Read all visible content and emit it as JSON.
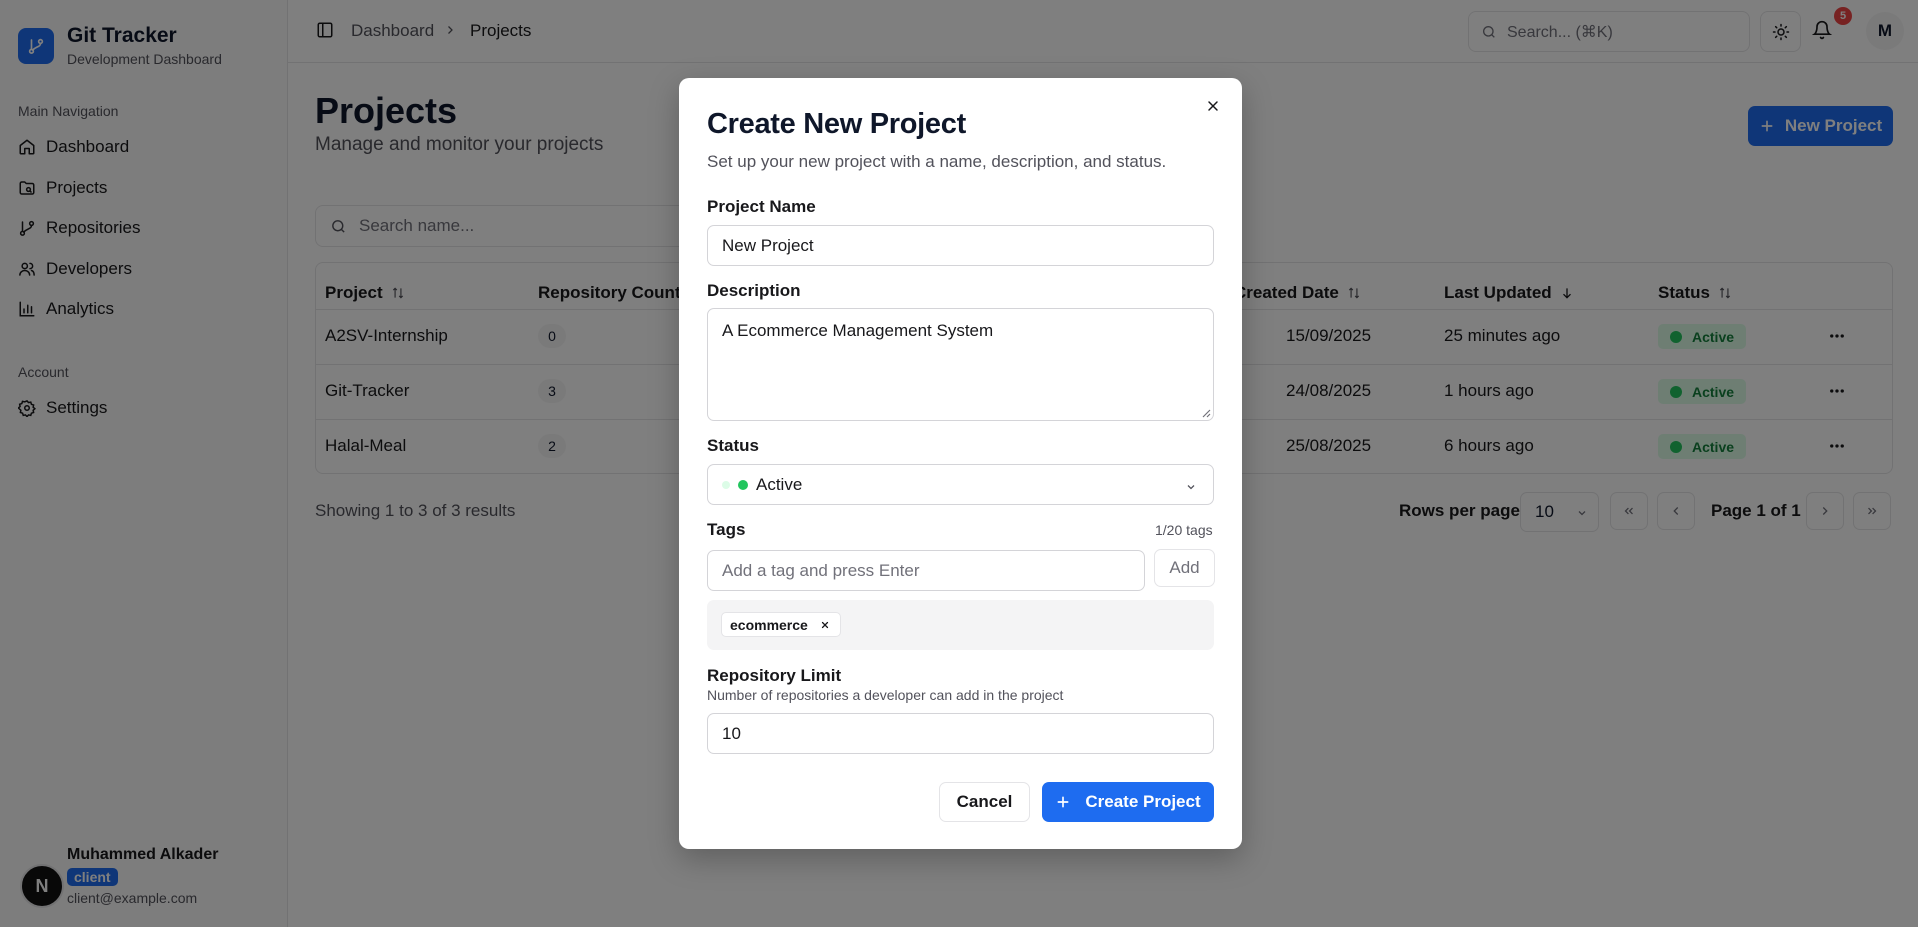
{
  "app": {
    "title": "Git Tracker",
    "subtitle": "Development Dashboard"
  },
  "sidebar": {
    "main_group_label": "Main Navigation",
    "items": [
      {
        "label": "Dashboard",
        "icon": "home-icon"
      },
      {
        "label": "Projects",
        "icon": "projects-icon"
      },
      {
        "label": "Repositories",
        "icon": "git-branch-icon"
      },
      {
        "label": "Developers",
        "icon": "users-icon"
      },
      {
        "label": "Analytics",
        "icon": "bar-chart-icon"
      }
    ],
    "account_group_label": "Account",
    "account_items": [
      {
        "label": "Settings",
        "icon": "gear-icon"
      }
    ]
  },
  "user": {
    "initial": "N",
    "name": "Muhammed Alkader",
    "role": "client",
    "email": "client@example.com"
  },
  "header": {
    "breadcrumb": [
      "Dashboard",
      "Projects"
    ],
    "search_placeholder": "Search... (⌘K)",
    "notification_count": "5",
    "avatar_initial": "M"
  },
  "main": {
    "title": "Projects",
    "subtitle": "Manage and monitor your projects",
    "new_button": "New Project",
    "search_placeholder": "Search name...",
    "columns": {
      "project": "Project",
      "repo_count": "Repository Count",
      "created": "Created Date",
      "updated": "Last Updated",
      "status": "Status"
    },
    "rows": [
      {
        "project": "A2SV-Internship",
        "repo_count": "0",
        "created": "15/09/2025",
        "updated": "25 minutes ago",
        "status": "Active"
      },
      {
        "project": "Git-Tracker",
        "repo_count": "3",
        "created": "24/08/2025",
        "updated": "1 hours ago",
        "status": "Active"
      },
      {
        "project": "Halal-Meal",
        "repo_count": "2",
        "created": "25/08/2025",
        "updated": "6 hours ago",
        "status": "Active"
      }
    ],
    "showing": "Showing 1 to 3 of 3 results",
    "rows_per_page_label": "Rows per page",
    "rows_per_page": "10",
    "page_label": "Page 1 of 1"
  },
  "modal": {
    "title": "Create New Project",
    "description": "Set up your new project with a name, description, and status.",
    "name_label": "Project Name",
    "name_value": "New Project",
    "desc_label": "Description",
    "desc_value": "A Ecommerce Management System",
    "status_label": "Status",
    "status_value": "Active",
    "tags_label": "Tags",
    "tags_count": "1/20 tags",
    "tag_placeholder": "Add a tag and press Enter",
    "add_label": "Add",
    "tags": [
      "ecommerce"
    ],
    "repo_limit_label": "Repository Limit",
    "repo_limit_help": "Number of repositories a developer can add in the project",
    "repo_limit_value": "10",
    "cancel_label": "Cancel",
    "create_label": "Create Project"
  },
  "colors": {
    "accent": "#1e6cf0",
    "active_bg": "#dcfce7",
    "active_text": "#15803d",
    "active_dot": "#22c55e",
    "badge_red": "#ef4444"
  }
}
